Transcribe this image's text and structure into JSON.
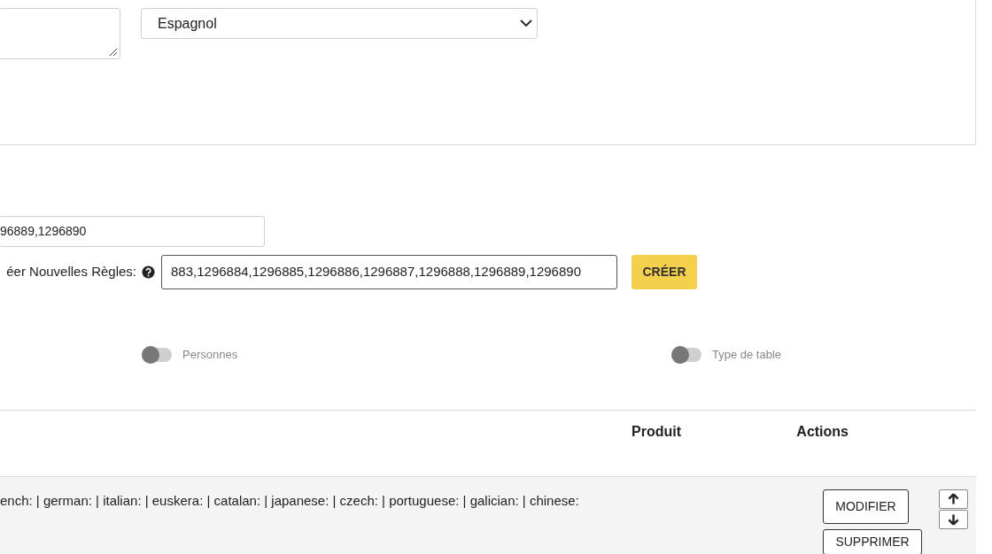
{
  "language_select": {
    "value": "Espagnol"
  },
  "rule_ids_field": {
    "value": "96889,1296890"
  },
  "new_rules": {
    "label": "éer Nouvelles Règles:",
    "value": "883,1296884,1296885,1296886,1296887,1296888,1296889,1296890",
    "button": "CRÉER"
  },
  "toggles": [
    {
      "label": "Personnes",
      "on": false
    },
    {
      "label": "Type de table",
      "on": false
    }
  ],
  "table": {
    "columns": [
      "Produit",
      "Actions"
    ],
    "rows": [
      {
        "column_1": "ench: | german: | italian: | euskera: | catalan: | japanese: | czech: | portuguese: | galician: | chinese:",
        "actions": [
          "MODIFIER",
          "SUPPRIMER"
        ]
      }
    ]
  }
}
